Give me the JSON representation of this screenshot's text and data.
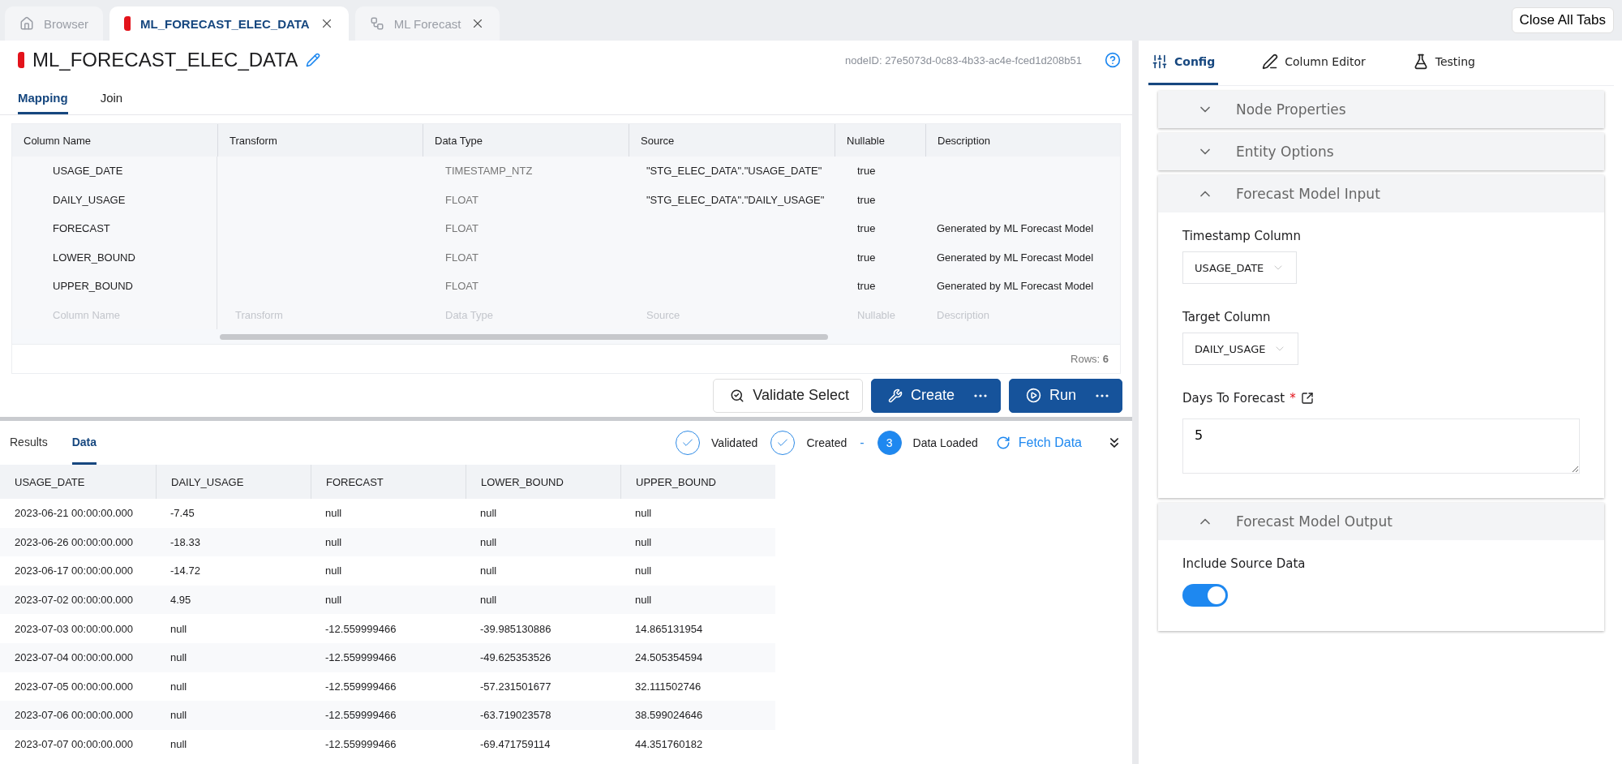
{
  "top_tabs": [
    {
      "kind": "home",
      "label": "Browser",
      "selected": false,
      "closable": false
    },
    {
      "kind": "node",
      "label": "ML_FORECAST_ELEC_DATA",
      "selected": true,
      "closable": true
    },
    {
      "kind": "graph",
      "label": "ML Forecast",
      "selected": false,
      "closable": true
    }
  ],
  "close_all": "Close All Tabs",
  "node": {
    "title": "ML_FORECAST_ELEC_DATA",
    "node_id": "nodeID: 27e5073d-0c83-4b33-ac4e-fced1d208b51"
  },
  "sub_tabs": [
    {
      "label": "Mapping",
      "selected": true
    },
    {
      "label": "Join",
      "selected": false
    }
  ],
  "mapping": {
    "columns": [
      "Column Name",
      "Transform",
      "Data Type",
      "Source",
      "Nullable",
      "Description"
    ],
    "rows": [
      [
        "USAGE_DATE",
        "",
        "TIMESTAMP_NTZ",
        "\"STG_ELEC_DATA\".\"USAGE_DATE\"",
        "true",
        ""
      ],
      [
        "DAILY_USAGE",
        "",
        "FLOAT",
        "\"STG_ELEC_DATA\".\"DAILY_USAGE\"",
        "true",
        ""
      ],
      [
        "FORECAST",
        "",
        "FLOAT",
        "",
        "true",
        "Generated by ML Forecast Model"
      ],
      [
        "LOWER_BOUND",
        "",
        "FLOAT",
        "",
        "true",
        "Generated by ML Forecast Model"
      ],
      [
        "UPPER_BOUND",
        "",
        "FLOAT",
        "",
        "true",
        "Generated by ML Forecast Model"
      ]
    ],
    "placeholders": [
      "Column Name",
      "Transform",
      "Data Type",
      "Source",
      "Nullable",
      "Description"
    ],
    "row_count": "Rows: **6**"
  },
  "actions": [
    {
      "kind": "validate",
      "label": "Validate Select"
    },
    {
      "kind": "create",
      "label": "Create"
    },
    {
      "kind": "run",
      "label": "Run"
    }
  ],
  "result_tabs": [
    {
      "label": "Results",
      "selected": false
    },
    {
      "label": "Data",
      "selected": true
    }
  ],
  "steps": [
    {
      "kind": "check",
      "label": "Validated"
    },
    {
      "kind": "check",
      "label": "Created"
    },
    {
      "kind": "number",
      "number": "3",
      "label": "Data Loaded"
    }
  ],
  "step_separator": "-",
  "fetch": "Fetch Data",
  "data": {
    "columns": [
      "USAGE_DATE",
      "DAILY_USAGE",
      "FORECAST",
      "LOWER_BOUND",
      "UPPER_BOUND"
    ],
    "rows": [
      [
        "2023-06-21 00:00:00.000",
        "-7.45",
        "null",
        "null",
        "null"
      ],
      [
        "2023-06-26 00:00:00.000",
        "-18.33",
        "null",
        "null",
        "null"
      ],
      [
        "2023-06-17 00:00:00.000",
        "-14.72",
        "null",
        "null",
        "null"
      ],
      [
        "2023-07-02 00:00:00.000",
        "4.95",
        "null",
        "null",
        "null"
      ],
      [
        "2023-07-03 00:00:00.000",
        "null",
        "-12.559999466",
        "-39.985130886",
        "14.865131954"
      ],
      [
        "2023-07-04 00:00:00.000",
        "null",
        "-12.559999466",
        "-49.625353526",
        "24.505354594"
      ],
      [
        "2023-07-05 00:00:00.000",
        "null",
        "-12.559999466",
        "-57.231501677",
        "32.111502746"
      ],
      [
        "2023-07-06 00:00:00.000",
        "null",
        "-12.559999466",
        "-63.719023578",
        "38.599024646"
      ],
      [
        "2023-07-07 00:00:00.000",
        "null",
        "-12.559999466",
        "-69.471759114",
        "44.351760182"
      ]
    ]
  },
  "side_tabs": [
    {
      "kind": "config",
      "label": "Config",
      "selected": true
    },
    {
      "kind": "editor",
      "label": "Column Editor",
      "selected": false
    },
    {
      "kind": "testing",
      "label": "Testing",
      "selected": false
    }
  ],
  "sections": [
    {
      "title": "Node Properties",
      "expanded": false
    },
    {
      "title": "Entity Options",
      "expanded": false
    },
    {
      "title": "Forecast Model Input",
      "expanded": true,
      "fields": [
        {
          "kind": "select",
          "label": "Timestamp Column",
          "value": "USAGE_DATE"
        },
        {
          "kind": "select",
          "label": "Target Column",
          "value": "DAILY_USAGE"
        },
        {
          "kind": "textarea",
          "label": "Days To Forecast",
          "required": true,
          "required_mark": "*",
          "value": "5"
        }
      ]
    },
    {
      "title": "Forecast Model Output",
      "expanded": true,
      "fields": [
        {
          "kind": "toggle",
          "label": "Include Source Data",
          "on": true
        }
      ]
    }
  ]
}
